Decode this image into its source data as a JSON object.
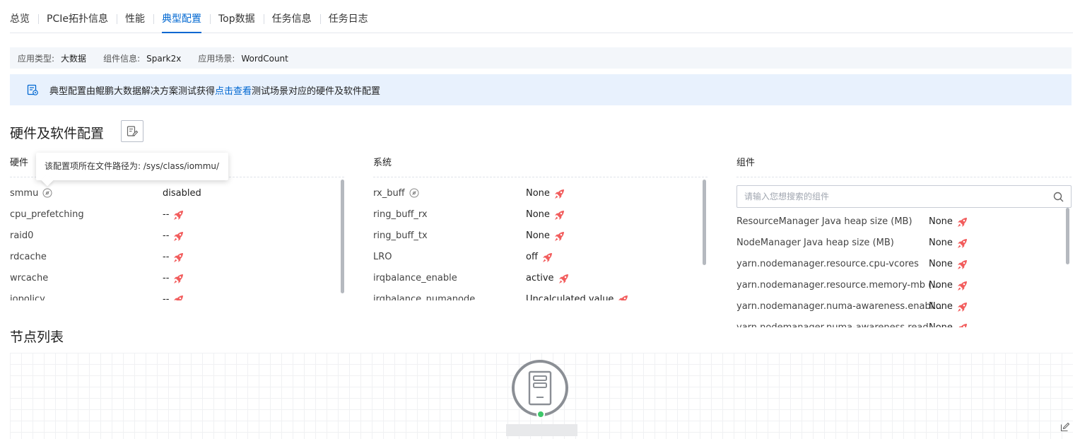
{
  "tabs": [
    {
      "label": "总览",
      "active": false
    },
    {
      "label": "PCIe拓扑信息",
      "active": false
    },
    {
      "label": "性能",
      "active": false
    },
    {
      "label": "典型配置",
      "active": true
    },
    {
      "label": "Top数据",
      "active": false
    },
    {
      "label": "任务信息",
      "active": false
    },
    {
      "label": "任务日志",
      "active": false
    }
  ],
  "info": {
    "app_type_key": "应用类型:",
    "app_type_val": "大数据",
    "component_key": "组件信息:",
    "component_val": "Spark2x",
    "scenario_key": "应用场景:",
    "scenario_val": "WordCount"
  },
  "notice": {
    "prefix": "典型配置由鲲鹏大数据解决方案测试获得",
    "link": "点击查看",
    "suffix": " 测试场景对应的硬件及软件配置"
  },
  "section_title": "硬件及软件配置",
  "tooltip": "该配置项所在文件路径为: /sys/class/iommu/",
  "hardware": {
    "title": "硬件",
    "rows": [
      {
        "key": "smmu",
        "value": "disabled",
        "info": true,
        "rocket": false
      },
      {
        "key": "cpu_prefetching",
        "value": "--",
        "info": false,
        "rocket": true
      },
      {
        "key": "raid0",
        "value": "--",
        "info": false,
        "rocket": true
      },
      {
        "key": "rdcache",
        "value": "--",
        "info": false,
        "rocket": true
      },
      {
        "key": "wrcache",
        "value": "--",
        "info": false,
        "rocket": true
      },
      {
        "key": "iopolicy",
        "value": "--",
        "info": false,
        "rocket": true
      }
    ]
  },
  "system": {
    "title": "系统",
    "rows": [
      {
        "key": "rx_buff",
        "value": "None",
        "info": true,
        "rocket": true
      },
      {
        "key": "ring_buff_rx",
        "value": "None",
        "info": false,
        "rocket": true
      },
      {
        "key": "ring_buff_tx",
        "value": "None",
        "info": false,
        "rocket": true
      },
      {
        "key": "LRO",
        "value": "off",
        "info": false,
        "rocket": true
      },
      {
        "key": "irqbalance_enable",
        "value": "active",
        "info": false,
        "rocket": true
      },
      {
        "key": "irqbalance_numanode",
        "value": "Uncalculated value",
        "info": false,
        "rocket": true
      }
    ]
  },
  "component": {
    "title": "组件",
    "search_placeholder": "请输入您想搜索的组件",
    "rows": [
      {
        "key": "ResourceManager Java heap size (MB)",
        "value": "None"
      },
      {
        "key": "NodeManager Java heap size (MB)",
        "value": "None"
      },
      {
        "key": "yarn.nodemanager.resource.cpu-vcores",
        "value": "None"
      },
      {
        "key": "yarn.nodemanager.resource.memory-mb (...",
        "value": "None"
      },
      {
        "key": "yarn.nodemanager.numa-awareness.enabl...",
        "value": "None"
      },
      {
        "key": "yarn.nodemanager.numa-awareness.read-...",
        "value": "None"
      }
    ]
  },
  "node_title": "节点列表",
  "colors": {
    "accent": "#0067d1",
    "rocket": "#f25c5c",
    "node_status": "#3ec76a"
  }
}
